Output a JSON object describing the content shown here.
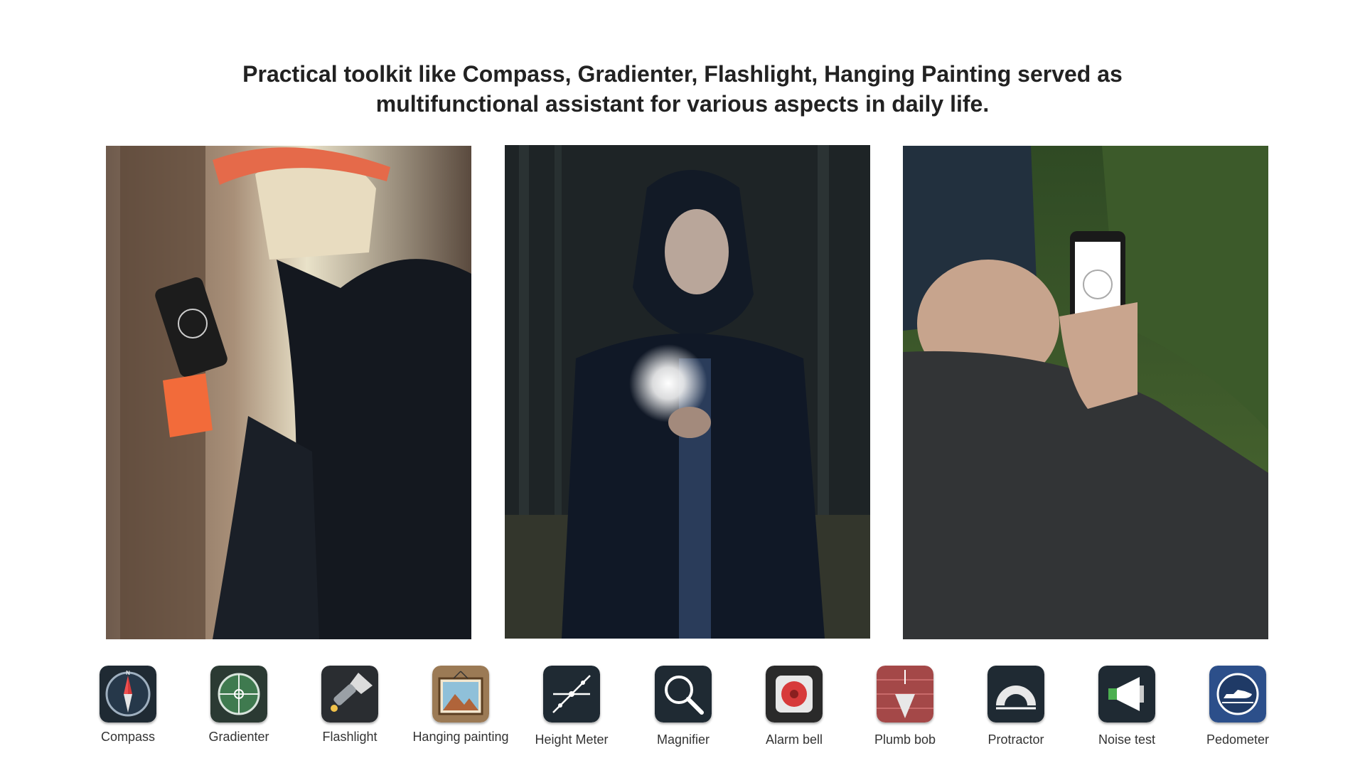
{
  "headline": {
    "line1": "Practical toolkit like Compass, Gradienter, Flashlight, Hanging Painting served as",
    "line2": "multifunctional assistant for various aspects in daily life."
  },
  "photos": [
    {
      "subject": "cyclist-checking-compass"
    },
    {
      "subject": "man-with-flashlight-in-dark-forest"
    },
    {
      "subject": "hiker-using-phone-on-mountain"
    }
  ],
  "tools": [
    {
      "label": "Compass",
      "icon": "compass-icon"
    },
    {
      "label": "Gradienter",
      "icon": "gradienter-icon"
    },
    {
      "label": "Flashlight",
      "icon": "flashlight-icon"
    },
    {
      "label": "Hanging painting",
      "icon": "hanging-painting-icon"
    },
    {
      "label": "Height Meter",
      "icon": "height-meter-icon"
    },
    {
      "label": "Magnifier",
      "icon": "magnifier-icon"
    },
    {
      "label": "Alarm bell",
      "icon": "alarm-bell-icon"
    },
    {
      "label": "Plumb bob",
      "icon": "plumb-bob-icon"
    },
    {
      "label": "Protractor",
      "icon": "protractor-icon"
    },
    {
      "label": "Noise test",
      "icon": "noise-test-icon"
    },
    {
      "label": "Pedometer",
      "icon": "pedometer-icon"
    }
  ],
  "colors": {
    "text": "#222222",
    "label": "#333333",
    "icon_dark": "#1f2a33",
    "accent_red": "#d73a3a",
    "accent_green": "#3f7a4f",
    "accent_blue": "#2c4f8a"
  }
}
